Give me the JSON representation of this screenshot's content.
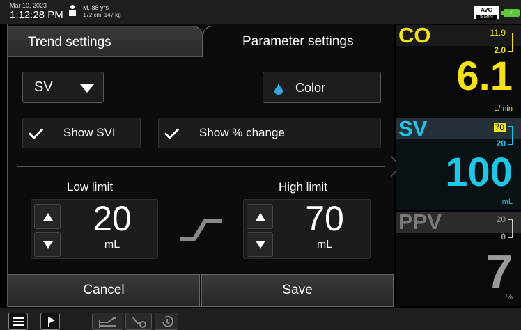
{
  "status_bar": {
    "date": "Mar 10, 2023",
    "time": "1:12:28 PM",
    "patient_line1": "M, 88 yrs",
    "patient_line2": "172 cm, 147 kg",
    "avg_label": "AVG",
    "avg_interval": "5 MIN"
  },
  "tabs": {
    "trend_settings": "Trend settings",
    "parameter_settings": "Parameter settings"
  },
  "parameter_select": {
    "value": "SV"
  },
  "color_button": {
    "label": "Color",
    "icon": "water-drop-icon",
    "icon_color": "#3aa6e0"
  },
  "checkboxes": {
    "show_svi": {
      "label": "Show SVI",
      "checked": true
    },
    "show_pct_change": {
      "label": "Show % change",
      "checked": true
    }
  },
  "limits": {
    "low": {
      "title": "Low limit",
      "value": "20",
      "unit": "mL"
    },
    "high": {
      "title": "High limit",
      "value": "70",
      "unit": "mL"
    }
  },
  "actions": {
    "cancel": "Cancel",
    "save": "Save"
  },
  "tiles": {
    "co": {
      "name": "CO",
      "target_high": "11.9",
      "target_low": "2.0",
      "value": "6.1",
      "unit": "L/min",
      "color": "#f5e11a"
    },
    "sv": {
      "name": "SV",
      "target_high": "70",
      "target_low": "20",
      "value": "100",
      "unit": "mL",
      "color": "#1fc6e8"
    },
    "ppv": {
      "name": "PPV",
      "target_high": "20",
      "target_low": "0",
      "value": "7",
      "unit": "%",
      "color": "#9a9a9a"
    }
  },
  "bottom_nav": [
    {
      "icon": "menu-icon"
    },
    {
      "icon": "flag-icon"
    },
    {
      "icon": "trend-chart-icon"
    },
    {
      "icon": "clinical-tools-icon"
    },
    {
      "icon": "history-icon"
    }
  ]
}
